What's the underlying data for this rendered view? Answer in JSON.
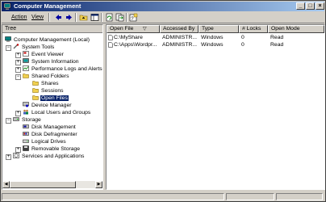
{
  "window": {
    "title": "Computer Management"
  },
  "menu": {
    "action": "Action",
    "view": "View"
  },
  "toolbar_icons": [
    "back-icon",
    "forward-icon",
    "up-folder-icon",
    "show-hide-tree-icon",
    "refresh-icon",
    "export-list-icon",
    "help-icon"
  ],
  "tree": {
    "tab_label": "Tree",
    "nodes": [
      {
        "label": "Computer Management (Local)",
        "icon": "computer-icon"
      },
      {
        "label": "System Tools",
        "icon": "tools-icon"
      },
      {
        "label": "Event Viewer",
        "icon": "event-viewer-icon"
      },
      {
        "label": "System Information",
        "icon": "info-icon"
      },
      {
        "label": "Performance Logs and Alerts",
        "icon": "performance-icon"
      },
      {
        "label": "Shared Folders",
        "icon": "folder-icon"
      },
      {
        "label": "Shares",
        "icon": "folder-icon"
      },
      {
        "label": "Sessions",
        "icon": "folder-icon"
      },
      {
        "label": "Open Files",
        "icon": "folder-icon"
      },
      {
        "label": "Device Manager",
        "icon": "device-icon"
      },
      {
        "label": "Local Users and Groups",
        "icon": "users-icon"
      },
      {
        "label": "Storage",
        "icon": "storage-icon"
      },
      {
        "label": "Disk Management",
        "icon": "disk-icon"
      },
      {
        "label": "Disk Defragmenter",
        "icon": "defrag-icon"
      },
      {
        "label": "Logical Drives",
        "icon": "drive-icon"
      },
      {
        "label": "Removable Storage",
        "icon": "removable-icon"
      },
      {
        "label": "Services and Applications",
        "icon": "services-icon"
      }
    ],
    "selected": "Open Files"
  },
  "list": {
    "columns": [
      "Open File",
      "Accessed By",
      "Type",
      "# Locks",
      "Open Mode"
    ],
    "sort_indicator": "▽",
    "rows": [
      [
        "C:\\MyShare",
        "ADMINISTR...",
        "Windows",
        "0",
        "Read"
      ],
      [
        "C:\\Apps\\Wordpr...",
        "ADMINISTR...",
        "Windows",
        "0",
        "Read"
      ]
    ]
  },
  "colors": {
    "title_start": "#0a246a",
    "title_end": "#a6caf0",
    "selection": "#0a246a",
    "chrome": "#d4d0c8"
  }
}
